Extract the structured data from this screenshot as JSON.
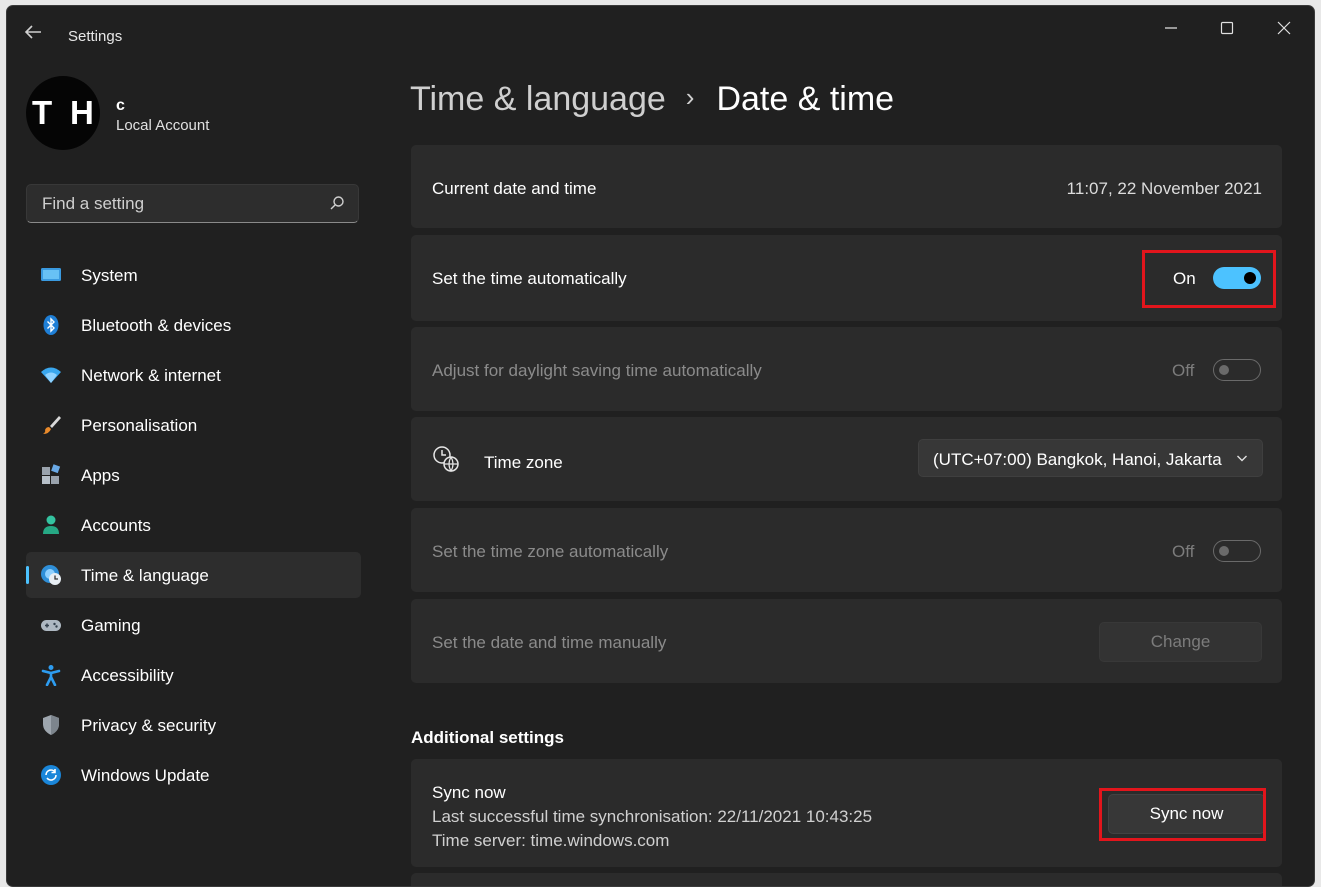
{
  "window": {
    "title": "Settings"
  },
  "profile": {
    "initials_left": "T",
    "initials_right": "H",
    "name": "c",
    "account_type": "Local Account"
  },
  "search": {
    "placeholder": "Find a setting"
  },
  "sidebar": {
    "items": [
      {
        "label": "System",
        "icon": "system-icon"
      },
      {
        "label": "Bluetooth & devices",
        "icon": "bluetooth-icon"
      },
      {
        "label": "Network & internet",
        "icon": "wifi-icon"
      },
      {
        "label": "Personalisation",
        "icon": "brush-icon"
      },
      {
        "label": "Apps",
        "icon": "apps-icon"
      },
      {
        "label": "Accounts",
        "icon": "person-icon"
      },
      {
        "label": "Time & language",
        "icon": "globe-clock-icon",
        "active": true
      },
      {
        "label": "Gaming",
        "icon": "gamepad-icon"
      },
      {
        "label": "Accessibility",
        "icon": "accessibility-icon"
      },
      {
        "label": "Privacy & security",
        "icon": "shield-icon"
      },
      {
        "label": "Windows Update",
        "icon": "update-icon"
      }
    ]
  },
  "breadcrumb": {
    "parent": "Time & language",
    "separator": "›",
    "current": "Date & time"
  },
  "settings": {
    "current_datetime": {
      "label": "Current date and time",
      "value": "11:07, 22 November 2021"
    },
    "auto_time": {
      "label": "Set the time automatically",
      "state": "On"
    },
    "daylight": {
      "label": "Adjust for daylight saving time automatically",
      "state": "Off"
    },
    "time_zone": {
      "label": "Time zone",
      "value": "(UTC+07:00) Bangkok, Hanoi, Jakarta"
    },
    "auto_timezone": {
      "label": "Set the time zone automatically",
      "state": "Off"
    },
    "manual": {
      "label": "Set the date and time manually",
      "button": "Change"
    }
  },
  "additional": {
    "title": "Additional settings",
    "sync": {
      "title": "Sync now",
      "last_sync": "Last successful time synchronisation: 22/11/2021 10:43:25",
      "server": "Time server: time.windows.com",
      "button": "Sync now"
    }
  },
  "colors": {
    "accent": "#4cc2ff",
    "highlight": "#e2151c",
    "background": "#202020",
    "card": "#2b2b2b"
  }
}
